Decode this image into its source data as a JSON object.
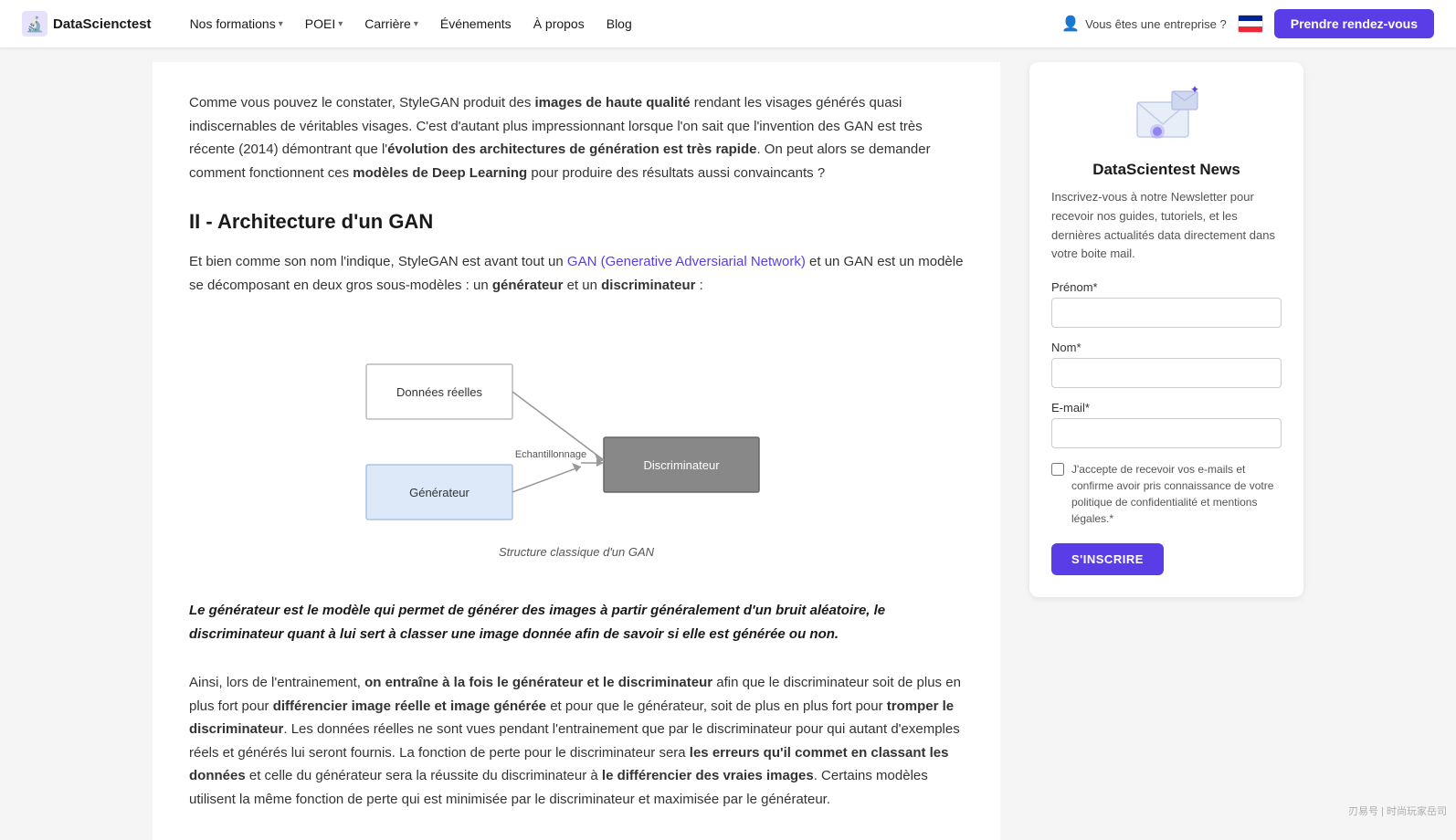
{
  "navbar": {
    "logo_text": "DataScienctest",
    "links": [
      {
        "label": "Nos formations",
        "has_chevron": true
      },
      {
        "label": "POEI",
        "has_chevron": true
      },
      {
        "label": "Carrière",
        "has_chevron": true
      },
      {
        "label": "Événements",
        "has_chevron": false
      },
      {
        "label": "À propos",
        "has_chevron": false
      },
      {
        "label": "Blog",
        "has_chevron": false
      }
    ],
    "enterprise_label": "Vous êtes une entreprise ?",
    "cta_label": "Prendre rendez-vous"
  },
  "article": {
    "intro_paragraph": "Comme vous pouvez le constater, StyleGAN produit des ",
    "intro_bold1": "images de haute qualité",
    "intro_mid": " rendant les visages générés quasi indiscernables de véritables visages. C'est d'autant plus impressionnant lorsque l'on sait que l'invention des GAN est très récente (2014) démontrant que l'",
    "intro_bold2": "évolution des architectures de génération est très rapide",
    "intro_end": ". On peut alors se demander comment fonctionnent ces ",
    "intro_bold3": "modèles de Deep Learning",
    "intro_end2": " pour produire des résultats aussi convaincants ?",
    "section_title": "II - Architecture d'un GAN",
    "section_intro_pre": "Et bien comme son nom l'indique, StyleGAN est avant tout un ",
    "section_link_text": "GAN (Generative Adversiarial Network)",
    "section_intro_post": " et un GAN est un modèle se décomposant en deux gros sous-modèles : un ",
    "section_bold_generateur": "générateur",
    "section_mid": " et un ",
    "section_bold_discriminateur": "discriminateur",
    "section_end": " :",
    "diagram_caption": "Structure classique d'un GAN",
    "diagram": {
      "donnees_label": "Données réelles",
      "echantillonnage_label": "Echantillonnage",
      "discriminateur_label": "Discriminateur",
      "generateur_label": "Générateur"
    },
    "bold_quote": "Le générateur est le modèle qui permet de générer des images à partir généralement d'un bruit aléatoire, le discriminateur quant à lui sert à classer une image donnée afin de savoir si elle est générée ou non.",
    "bottom_p1": "Ainsi, lors de l'entrainement, ",
    "bottom_bold1": "on entraîne à la fois le générateur et le discriminateur",
    "bottom_p2": " afin que le discriminateur soit de plus en plus fort pour ",
    "bottom_bold2": "différencier image réelle et image générée",
    "bottom_p3": " et pour que le générateur, soit de plus en plus fort pour ",
    "bottom_bold3": "tromper le discriminateur",
    "bottom_p4": ". Les données réelles ne sont vues pendant l'entrainement que par le discriminateur pour qui autant d'exemples réels et générés lui seront fournis. La fonction de perte pour le discriminateur sera ",
    "bottom_bold4": "les erreurs qu'il commet en classant les données",
    "bottom_p5": " et celle du générateur sera la réussite du discriminateur à ",
    "bottom_bold5": "le différencier des vraies images",
    "bottom_p6": ". Certains modèles utilisent la même fonction de perte qui est minimisée par le discriminateur et maximisée par le générateur."
  },
  "sidebar": {
    "title": "DataScientest News",
    "description": "Inscrivez-vous à notre Newsletter pour recevoir nos guides, tutoriels, et les dernières actualités data directement dans votre boite mail.",
    "prenom_label": "Prénom*",
    "nom_label": "Nom*",
    "email_label": "E-mail*",
    "checkbox_text": "J'accepte de recevoir vos e-mails et confirme avoir pris connaissance de votre politique de confidentialité et mentions légales.*",
    "submit_label": "S'INSCRIRE"
  }
}
